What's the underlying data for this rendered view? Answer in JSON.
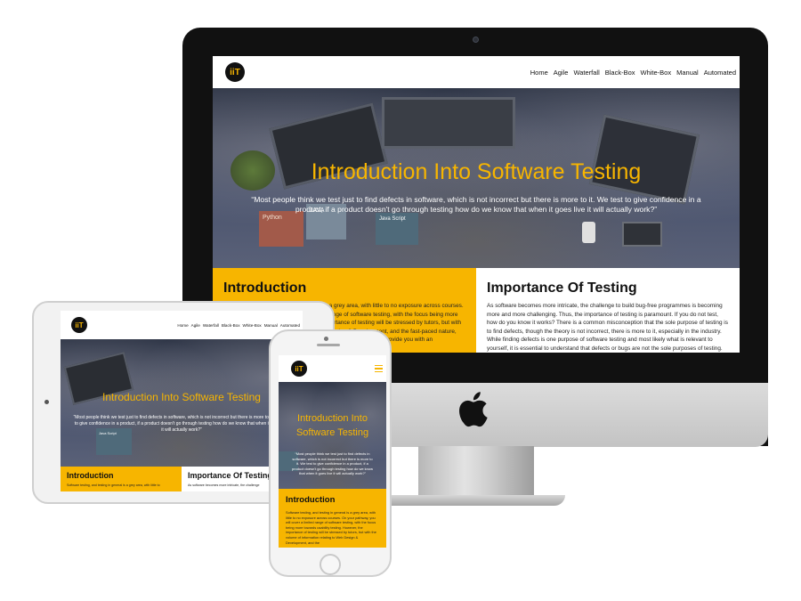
{
  "brand": {
    "logo_text": "iiT"
  },
  "nav": {
    "items": [
      "Home",
      "Agile",
      "Waterfall",
      "Black-Box",
      "White-Box",
      "Manual",
      "Automated"
    ]
  },
  "hero": {
    "title": "Introduction Into Software Testing",
    "quote": "“Most people think we test just to find defects in software, which is not incorrect but there is more to it. We test to give confidence in a product, if a product doesn't go through testing how do we know that when it goes live it will actually work?”"
  },
  "hero_props": {
    "book1": "Python",
    "book2": "JAVA",
    "book3": "Java Script"
  },
  "introduction": {
    "title": "Introduction",
    "text_desktop": "Software testing, and testing in general is a grey area, with little to no exposure across courses. On your pathway, you will cover a limited range of software testing, with the focus being more towards usability testing. However, the importance of testing will be stressed by tutors, but with the volume of information relating to Web Design & Development, and the fast-paced nature, testing can sometimes become a secondary thing. This site will provide you with an",
    "text_mobile": "Software testing, and testing in general is a grey area, with little to no exposure across courses. On your pathway, you will cover a limited range of software testing, with the focus being more towards usability testing. However, the importance of testing will be stressed by tutors, but with the volume of information relating to Web Design & Development, and the",
    "text_tablet": "Software testing, and testing in general is a grey area, with little to"
  },
  "importance": {
    "title": "Importance Of Testing",
    "text": "As software becomes more intricate, the challenge to build bug-free programmes is becoming more and more challenging. Thus, the importance of testing is paramount. If you do not test, how do you know it works? There is a common misconception that the sole purpose of testing is to find defects, though the theory is not incorrect, there is more to it, especially in the industry. While finding defects is one purpose of software testing and most likely what is relevant to yourself, it is essential to understand that defects or bugs are not the sole purposes of testing.",
    "text_tablet": "As software becomes more intricate, the challenge"
  },
  "colors": {
    "accent": "#f7b500",
    "dark": "#111111",
    "hero_bg": "#3c4459"
  },
  "icons": {
    "apple": "apple-logo-icon",
    "menu": "hamburger-menu-icon"
  }
}
